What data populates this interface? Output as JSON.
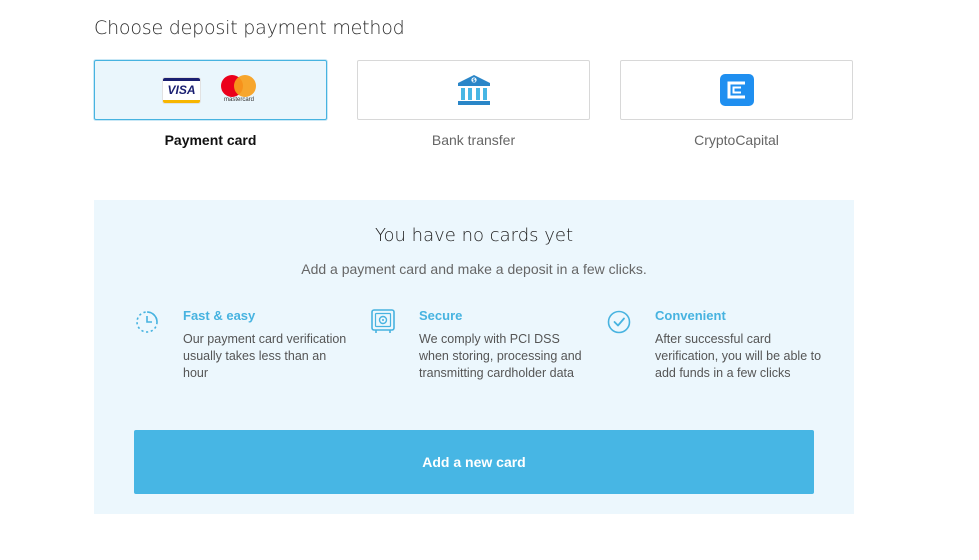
{
  "heading": "Choose deposit payment method",
  "methods": [
    {
      "label": "Payment card",
      "selected": true,
      "icons": [
        "visa-icon",
        "mastercard-icon"
      ],
      "visa_text": "VISA",
      "mastercard_text": "mastercard"
    },
    {
      "label": "Bank transfer",
      "selected": false,
      "icons": [
        "bank-icon"
      ]
    },
    {
      "label": "CryptoCapital",
      "selected": false,
      "icons": [
        "cryptocapital-icon"
      ]
    }
  ],
  "panel": {
    "title": "You have no cards yet",
    "subtitle": "Add a payment card and make a deposit in a few clicks.",
    "features": [
      {
        "icon": "clock-icon",
        "title": "Fast & easy",
        "text": "Our payment card verification usually takes less than an hour"
      },
      {
        "icon": "safe-icon",
        "title": "Secure",
        "text": "We comply with PCI DSS when storing, processing and transmitting cardholder data"
      },
      {
        "icon": "check-circle-icon",
        "title": "Convenient",
        "text": "After successful card verification, you will be able to add funds in a few clicks"
      }
    ],
    "button_label": "Add a new card"
  },
  "colors": {
    "accent": "#47b6e4",
    "panel_bg": "#ecf7fd",
    "selected_border": "#47b3e0",
    "selected_bg": "#eaf6fc",
    "cryptocapital_blue": "#1f8ff0",
    "visa_blue": "#1a1f71",
    "visa_gold": "#f7b600",
    "mastercard_red": "#eb001b",
    "mastercard_orange": "#f79e1b"
  }
}
